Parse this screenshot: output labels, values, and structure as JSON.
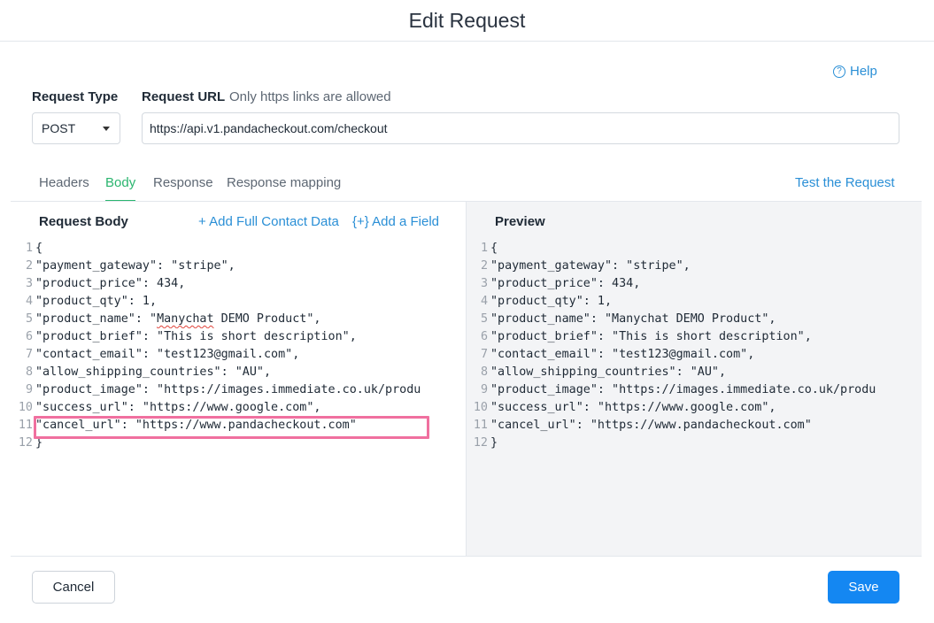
{
  "dialog": {
    "title": "Edit Request"
  },
  "help": {
    "label": "Help",
    "icon": "question-circle-icon"
  },
  "request_type": {
    "label": "Request Type",
    "value": "POST"
  },
  "request_url": {
    "label": "Request URL",
    "note": "Only https links are allowed",
    "value": "https://api.v1.pandacheckout.com/checkout"
  },
  "tabs": [
    {
      "label": "Headers",
      "active": false
    },
    {
      "label": "Body",
      "active": true
    },
    {
      "label": "Response",
      "active": false
    },
    {
      "label": "Response mapping",
      "active": false
    }
  ],
  "test_request": {
    "label": "Test the Request"
  },
  "request_body": {
    "title": "Request Body",
    "add_contact_label": "+ Add Full Contact Data",
    "add_field_label": "{+} Add a Field",
    "lines": [
      "{",
      "\"payment_gateway\": \"stripe\",",
      "\"product_price\": 434,",
      "\"product_qty\": 1,",
      "\"product_name\": \"Manychat DEMO Product\",",
      "\"product_brief\": \"This is short description\",",
      "\"contact_email\": \"test123@gmail.com\",",
      "\"allow_shipping_countries\": \"AU\",",
      "\"product_image\": \"https://images.immediate.co.uk/produ",
      "\"success_url\": \"https://www.google.com\",",
      "\"cancel_url\": \"https://www.pandacheckout.com\"",
      "}"
    ]
  },
  "preview": {
    "title": "Preview",
    "lines": [
      "{",
      "\"payment_gateway\": \"stripe\",",
      "\"product_price\": 434,",
      "\"product_qty\": 1,",
      "\"product_name\": \"Manychat DEMO Product\",",
      "\"product_brief\": \"This is short description\",",
      "\"contact_email\": \"test123@gmail.com\",",
      "\"allow_shipping_countries\": \"AU\",",
      "\"product_image\": \"https://images.immediate.co.uk/produ",
      "\"success_url\": \"https://www.google.com\",",
      "\"cancel_url\": \"https://www.pandacheckout.com\"",
      "}"
    ]
  },
  "footer": {
    "cancel_label": "Cancel",
    "save_label": "Save"
  },
  "colors": {
    "accent_green": "#2bb56f",
    "link_blue": "#2a8fd6",
    "primary_button": "#1487f2",
    "highlight": "#f0709f"
  }
}
